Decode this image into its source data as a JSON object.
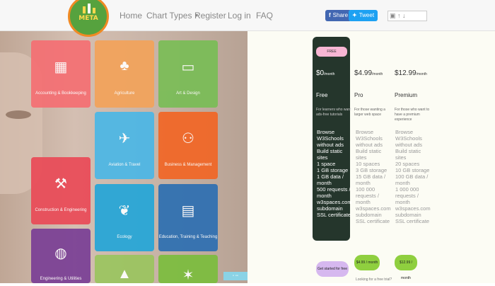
{
  "nav": {
    "logo_text": "META",
    "links": [
      "Home",
      "Chart Types",
      "Register",
      "Log in",
      "FAQ"
    ],
    "share": {
      "facebook": "Share",
      "twitter": "Tweet"
    }
  },
  "tiles": [
    {
      "label": "Accounting & Bookkeeping",
      "color": "#f56f73"
    },
    {
      "label": "Agriculture",
      "color": "#f3a35a"
    },
    {
      "label": "Art & Design",
      "color": "#79bd56"
    },
    {
      "label": "Aviation & Travel",
      "color": "#4bb7e6"
    },
    {
      "label": "Business & Management",
      "color": "#f26625"
    },
    {
      "label": "Construction & Engineering",
      "color": "#ea4a57"
    },
    {
      "label": "Ecology",
      "color": "#24a6d8"
    },
    {
      "label": "Education, Training & Teaching",
      "color": "#2d6fb2"
    },
    {
      "label": "Engineering & Utilities",
      "color": "#7a3f95"
    },
    {
      "label": "",
      "color": "#9bc55f"
    },
    {
      "label": "",
      "color": "#7bbd3d"
    }
  ],
  "pricing": {
    "badge": "FREE",
    "plans": [
      {
        "name": "Free",
        "price": "$0",
        "per": "/month",
        "desc": "For learners who want ads-free tutorials"
      },
      {
        "name": "Pro",
        "price": "$4.99",
        "per": "/month",
        "desc": "For those wanting a larger web space"
      },
      {
        "name": "Premium",
        "price": "$12.99",
        "per": "/month",
        "desc": "For those who want to have a premium experience"
      }
    ],
    "features_free": [
      "Browse W3Schools without ads",
      "Build static sites",
      "1 space",
      "1 GB storage",
      "1 GB data / month",
      "500 requests / month",
      "w3spaces.com subdomain",
      "SSL certificate"
    ],
    "features_pro": [
      "Browse W3Schools without ads",
      "Build static sites",
      "10 spaces",
      "3 GB storage",
      "15 GB data / month",
      "100 000 requests / month",
      "w3spaces.com subdomain",
      "SSL certificate"
    ],
    "features_prem": [
      "Browse W3Schools without ads",
      "Build static sites",
      "20 spaces",
      "10 GB storage",
      "100 GB data / month",
      "1 000 000 requests / month",
      "w3spaces.com subdomain",
      "SSL certificate"
    ],
    "buttons": [
      "Get started for free",
      "$4.99 / month",
      "$12.99 / month"
    ],
    "footnote": "Looking for a free trial?"
  }
}
